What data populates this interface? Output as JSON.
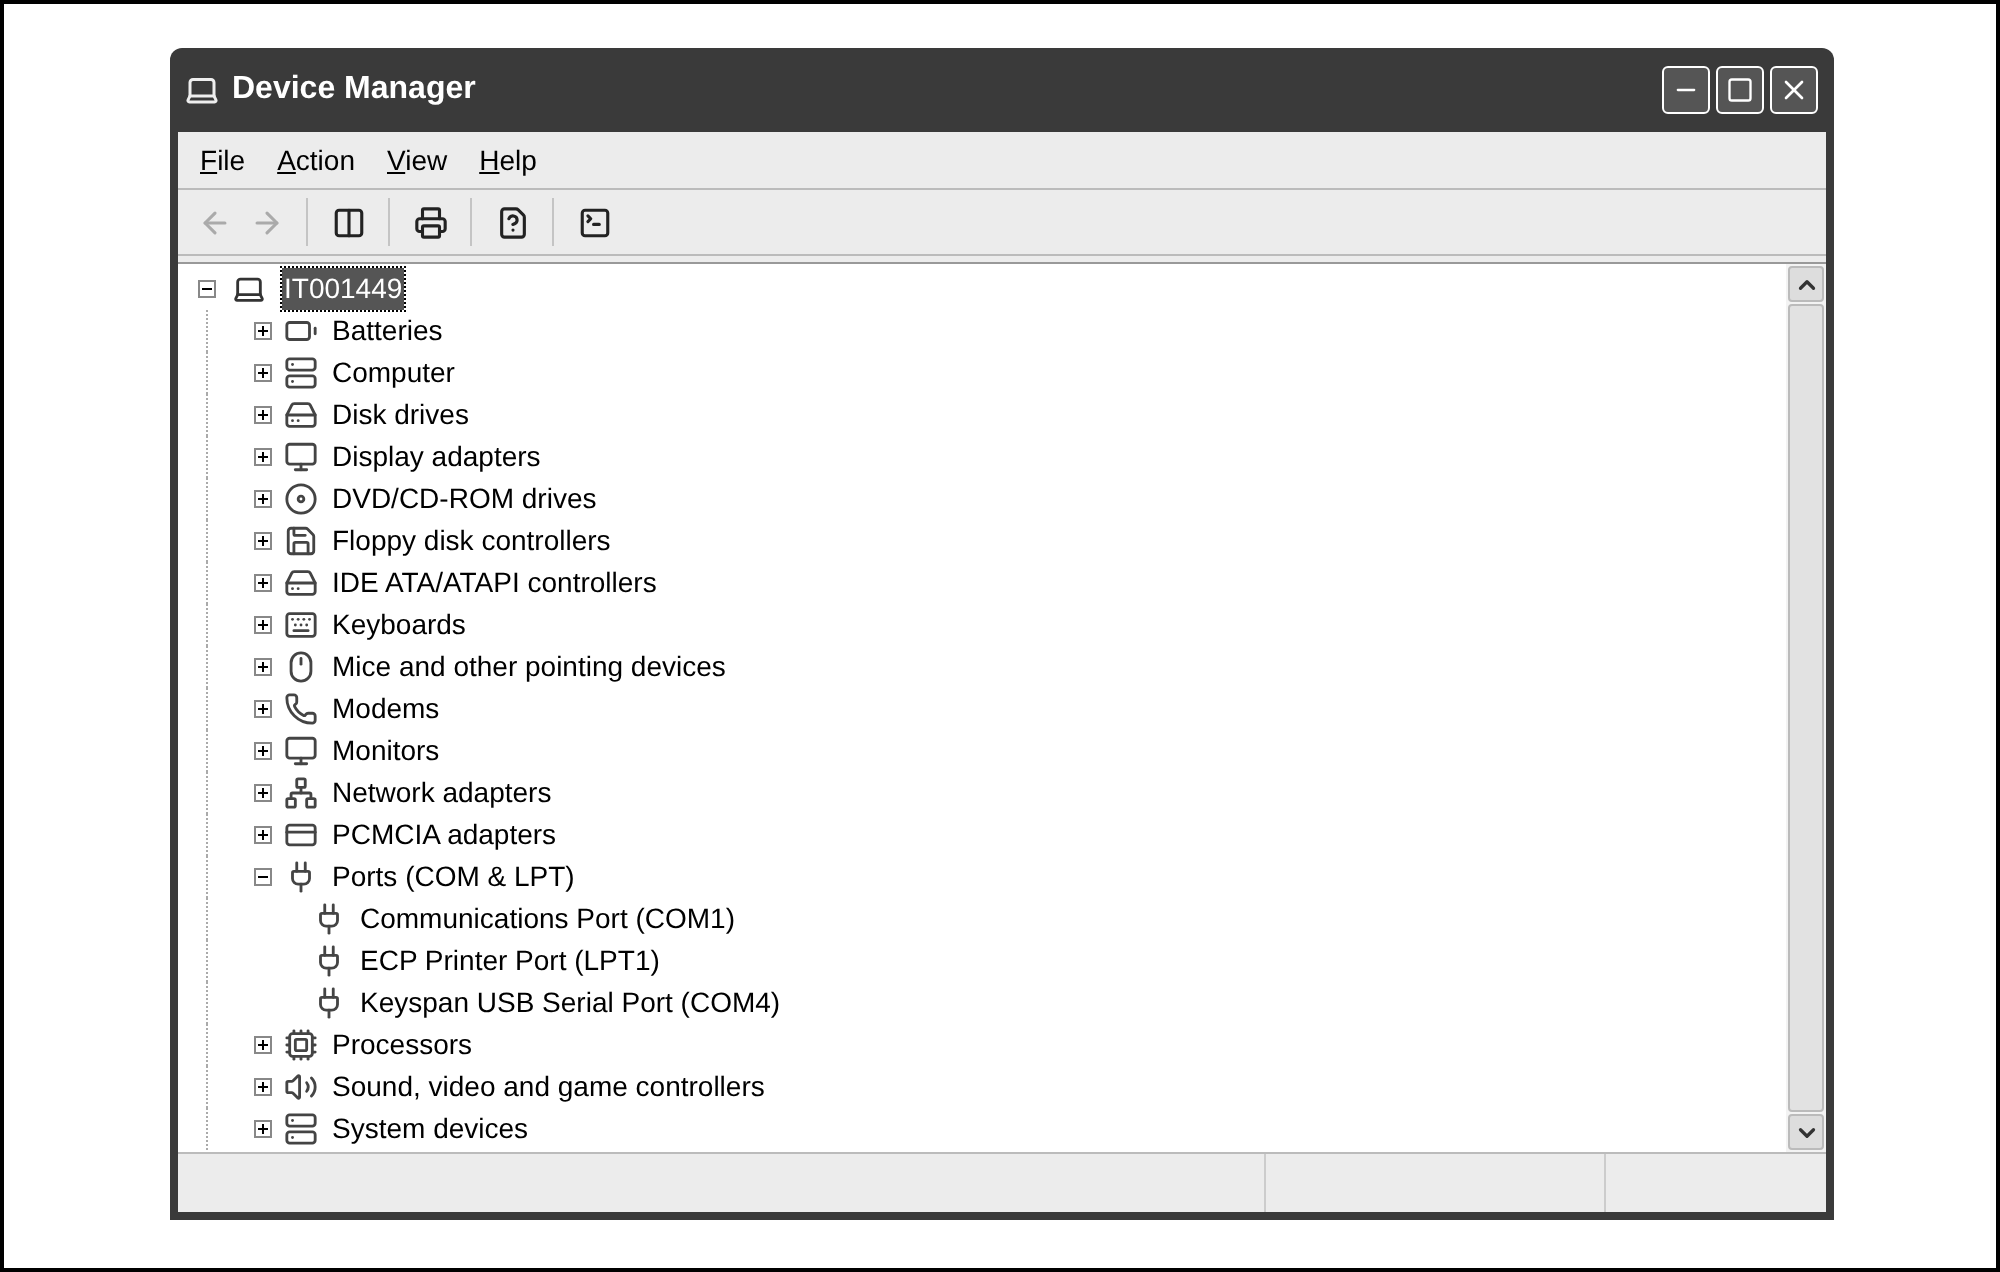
{
  "window": {
    "title": "Device Manager"
  },
  "menu": [
    {
      "label": "File"
    },
    {
      "label": "Action"
    },
    {
      "label": "View"
    },
    {
      "label": "Help"
    }
  ],
  "toolbar": [
    {
      "disabled": true
    },
    {
      "disabled": true
    },
    {
      "disabled": false
    },
    {
      "disabled": false
    },
    {
      "disabled": false
    },
    {
      "disabled": false
    }
  ],
  "tree": {
    "label": "IT001449",
    "expanded": true,
    "selected": true,
    "children": [
      {
        "label": "Batteries",
        "expanded": false,
        "selected": false
      },
      {
        "label": "Computer",
        "expanded": false,
        "selected": false
      },
      {
        "label": "Disk drives",
        "expanded": false,
        "selected": false
      },
      {
        "label": "Display adapters",
        "expanded": false,
        "selected": false
      },
      {
        "label": "DVD/CD-ROM drives",
        "expanded": false,
        "selected": false
      },
      {
        "label": "Floppy disk controllers",
        "expanded": false,
        "selected": false
      },
      {
        "label": "IDE ATA/ATAPI controllers",
        "expanded": false,
        "selected": false
      },
      {
        "label": "Keyboards",
        "expanded": false,
        "selected": false
      },
      {
        "label": "Mice and other pointing devices",
        "expanded": false,
        "selected": false
      },
      {
        "label": "Modems",
        "expanded": false,
        "selected": false
      },
      {
        "label": "Monitors",
        "expanded": false,
        "selected": false
      },
      {
        "label": "Network adapters",
        "expanded": false,
        "selected": false
      },
      {
        "label": "PCMCIA adapters",
        "expanded": false,
        "selected": false
      },
      {
        "label": "Ports (COM & LPT)",
        "expanded": true,
        "selected": false,
        "children": [
          {
            "label": "Communications Port (COM1)",
            "selected": false
          },
          {
            "label": "ECP Printer Port (LPT1)",
            "selected": false
          },
          {
            "label": "Keyspan USB Serial Port (COM4)",
            "selected": false
          }
        ]
      },
      {
        "label": "Processors",
        "expanded": false,
        "selected": false
      },
      {
        "label": "Sound, video and game controllers",
        "expanded": false,
        "selected": false
      },
      {
        "label": "System devices",
        "expanded": false,
        "selected": false
      }
    ]
  }
}
